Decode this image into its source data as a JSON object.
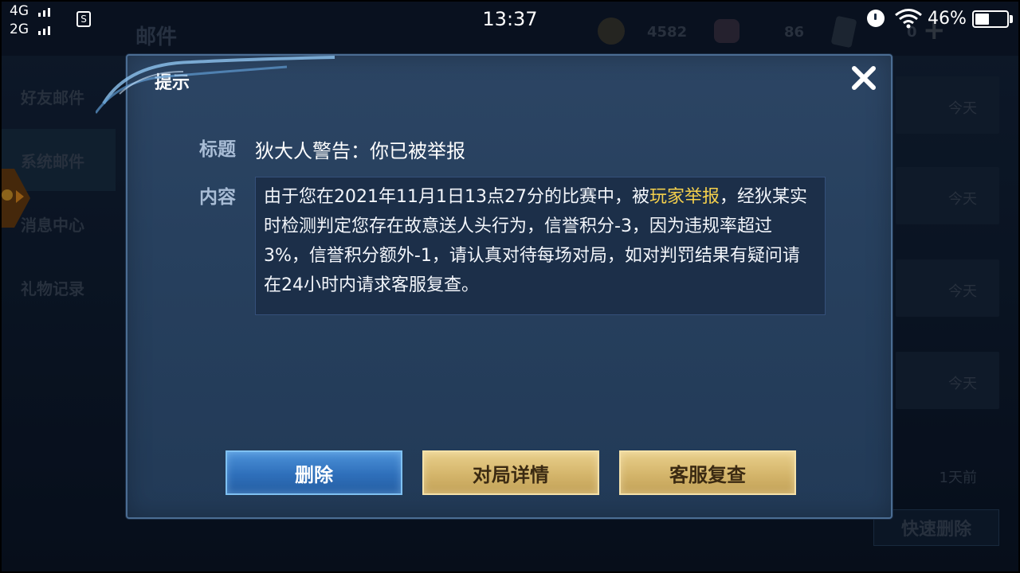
{
  "status_bar": {
    "network_1": "4G",
    "network_2": "2G",
    "sim_label": "S",
    "time": "13:37",
    "battery_text": "46%",
    "battery_level": 0.46
  },
  "background": {
    "page_title": "邮件",
    "coins": "4582",
    "gems": "86",
    "cards": "0",
    "sidebar": [
      {
        "label": "好友邮件"
      },
      {
        "label": "系统邮件"
      },
      {
        "label": "消息中心"
      },
      {
        "label": "礼物记录"
      }
    ],
    "list_times": [
      "今天",
      "今天",
      "今天",
      "今天",
      "1天前"
    ],
    "quick_delete_label": "快速删除"
  },
  "dialog": {
    "title": "提示",
    "title_label": "标题",
    "mail_title": "狄大人警告：你已被举报",
    "content_label": "内容",
    "content_before": "由于您在2021年11月1日13点27分的比赛中，被",
    "content_highlight": "玩家举报",
    "content_after": "，经狄某实时检测判定您存在故意送人头行为，信誉积分-3，因为违规率超过3%，信誉积分额外-1，请认真对待每场对局，如对判罚结果有疑问请在24小时内请求客服复查。",
    "buttons": {
      "delete": "删除",
      "match_details": "对局详情",
      "support_review": "客服复查"
    }
  },
  "colors": {
    "highlight": "#f3cf4c",
    "dialog_bg": "#27405e",
    "blue_button": "#2e6fba",
    "gold_button": "#d4b56b"
  }
}
